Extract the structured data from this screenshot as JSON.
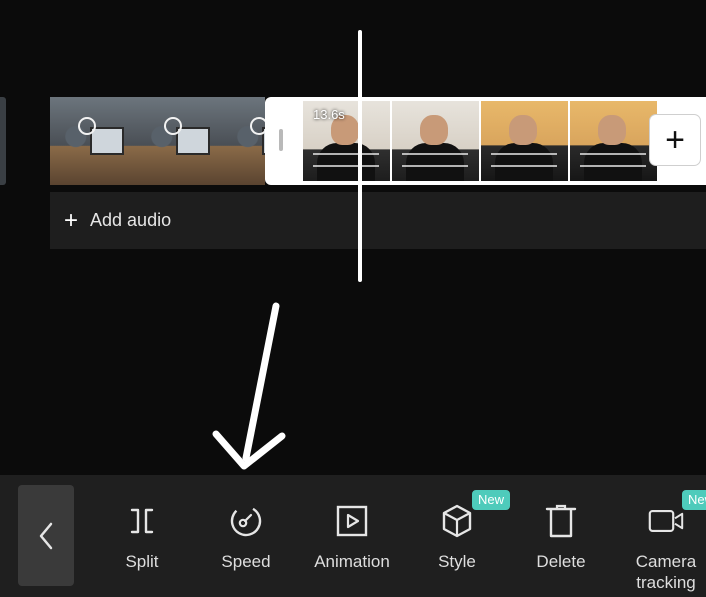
{
  "timeline": {
    "selected_clip_duration": "13.6s",
    "add_audio_label": "Add audio",
    "add_clip_symbol": "+"
  },
  "toolbar": {
    "back_icon": "chevron-left-icon",
    "tools": [
      {
        "label": "Split",
        "icon": "split-icon"
      },
      {
        "label": "Speed",
        "icon": "speed-icon"
      },
      {
        "label": "Animation",
        "icon": "animation-icon"
      },
      {
        "label": "Style",
        "icon": "cube-icon",
        "badge": "New"
      },
      {
        "label": "Delete",
        "icon": "trash-icon"
      },
      {
        "label_line1": "Camera",
        "label_line2": "tracking",
        "icon": "camera-icon",
        "badge": "New"
      }
    ]
  },
  "colors": {
    "background": "#0b0b0b",
    "toolbar": "#1f1f1f",
    "badge": "#4ecbbb",
    "selected_clip_border": "#ffffff"
  }
}
